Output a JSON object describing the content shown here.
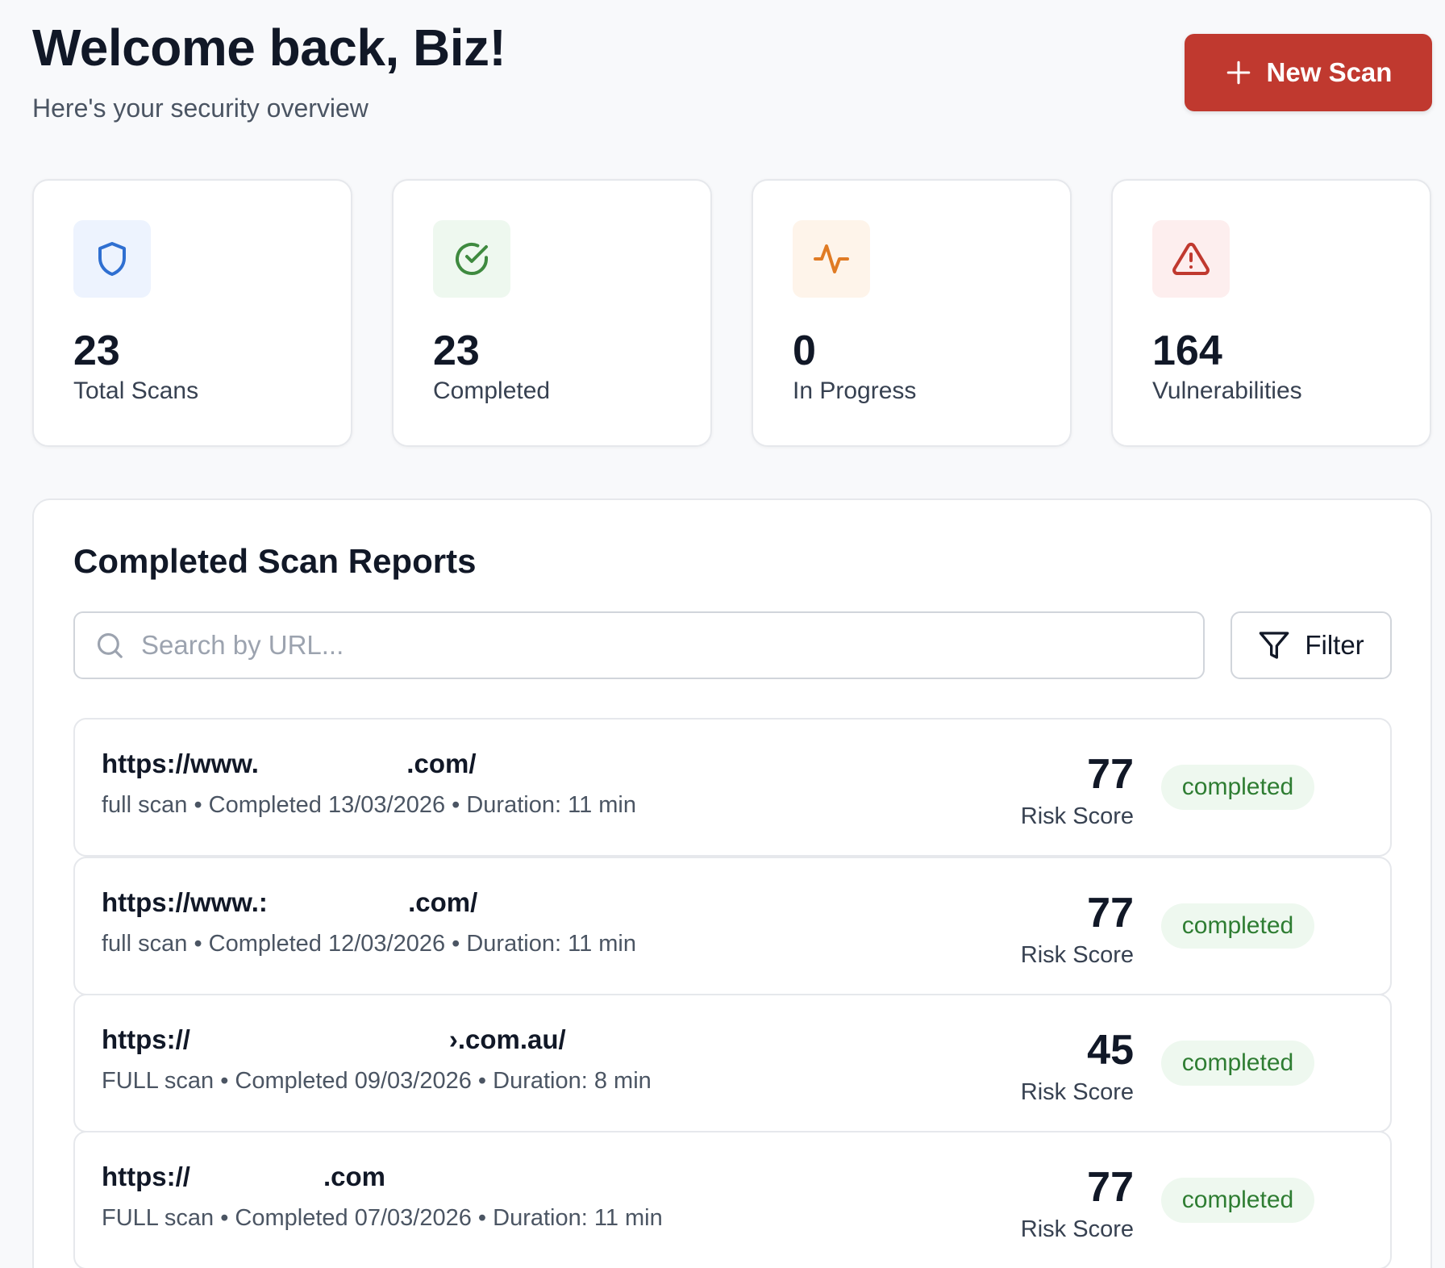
{
  "header": {
    "title": "Welcome back, Biz!",
    "subtitle": "Here's your security overview",
    "new_scan_label": "New Scan"
  },
  "stats": [
    {
      "value": "23",
      "label": "Total Scans",
      "icon": "shield-icon",
      "color": "#2f6fd1",
      "bg": "#edf3fe"
    },
    {
      "value": "23",
      "label": "Completed",
      "icon": "check-circle-icon",
      "color": "#3e8a3f",
      "bg": "#eef8ef"
    },
    {
      "value": "0",
      "label": "In Progress",
      "icon": "activity-icon",
      "color": "#e07b24",
      "bg": "#fef4ea"
    },
    {
      "value": "164",
      "label": "Vulnerabilities",
      "icon": "warning-triangle-icon",
      "color": "#c0392f",
      "bg": "#fdeeee"
    }
  ],
  "reports": {
    "title": "Completed Scan Reports",
    "search_placeholder": "Search by URL...",
    "filter_label": "Filter",
    "risk_label": "Risk Score",
    "rows": [
      {
        "url": "https://www.                    .com/",
        "meta": "full scan • Completed 13/03/2026 • Duration: 11 min",
        "risk": "77",
        "status": "completed"
      },
      {
        "url": "https://www.:                   .com/",
        "meta": "full scan • Completed 12/03/2026 • Duration: 11 min",
        "risk": "77",
        "status": "completed"
      },
      {
        "url": "https://                                   ›.com.au/",
        "meta": "FULL scan • Completed 09/03/2026 • Duration: 8 min",
        "risk": "45",
        "status": "completed"
      },
      {
        "url": "https://                  .com",
        "meta": "FULL scan • Completed 07/03/2026 • Duration: 11 min",
        "risk": "77",
        "status": "completed"
      }
    ]
  },
  "colors": {
    "accent": "#c0392f",
    "status_green": "#2e7d32"
  }
}
